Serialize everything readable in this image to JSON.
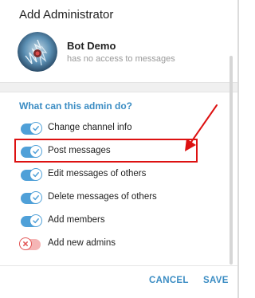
{
  "dialog": {
    "title": "Add Administrator"
  },
  "bot": {
    "name": "Bot Demo",
    "status": "has no access to messages"
  },
  "permissions": {
    "section_title": "What can this admin do?",
    "items": [
      {
        "label": "Change channel info",
        "enabled": true
      },
      {
        "label": "Post messages",
        "enabled": true,
        "highlighted": true
      },
      {
        "label": "Edit messages of others",
        "enabled": true
      },
      {
        "label": "Delete messages of others",
        "enabled": true
      },
      {
        "label": "Add members",
        "enabled": true
      },
      {
        "label": "Add new admins",
        "enabled": false
      }
    ]
  },
  "footer": {
    "cancel_label": "CANCEL",
    "save_label": "SAVE"
  },
  "colors": {
    "accent": "#3a8cc3",
    "toggle_on": "#4fa0d8",
    "toggle_off": "#e25555",
    "annotation": "#dd1111"
  },
  "icons": {
    "toggle_on_knob": "check-icon",
    "toggle_off_knob": "cross-icon",
    "annotation": "red-arrow-icon"
  }
}
